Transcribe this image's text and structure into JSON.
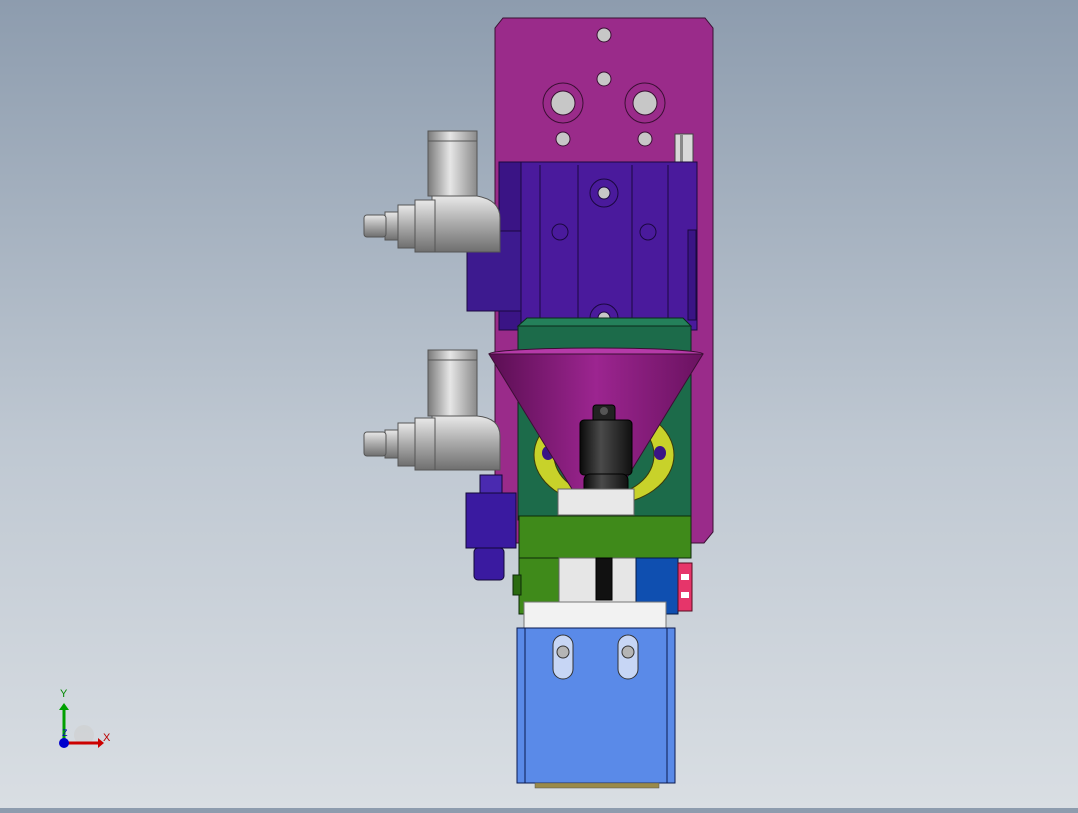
{
  "viewport": {
    "background_top": "#8d9cae",
    "background_bottom": "#d9dee3"
  },
  "model": {
    "colors": {
      "mount_plate": "#9a2b8a",
      "cylinder_body": "#4a1a9c",
      "side_block": "#3d1a8f",
      "green_block": "#1c6b4a",
      "funnel": "#8a1a7c",
      "yellow_ring": "#c8d22a",
      "nozzle": "#1a1a1a",
      "lime_bracket": "#3f8a1a",
      "blue_block": "#0f4fb0",
      "pink_tab": "#e6356a",
      "gripper_body": "#5a8ae8",
      "fitting_metal": "#b8b8b8",
      "sensor": "#3a1aa0"
    },
    "icons": [
      "pneumatic-fitting-icon",
      "pneumatic-fitting-icon",
      "proximity-sensor-icon"
    ]
  },
  "triad": {
    "x_label": "X",
    "y_label": "Y",
    "z_label": "Z",
    "colors": {
      "x": "#cc0000",
      "y": "#00a000",
      "z": "#0000cc"
    }
  }
}
